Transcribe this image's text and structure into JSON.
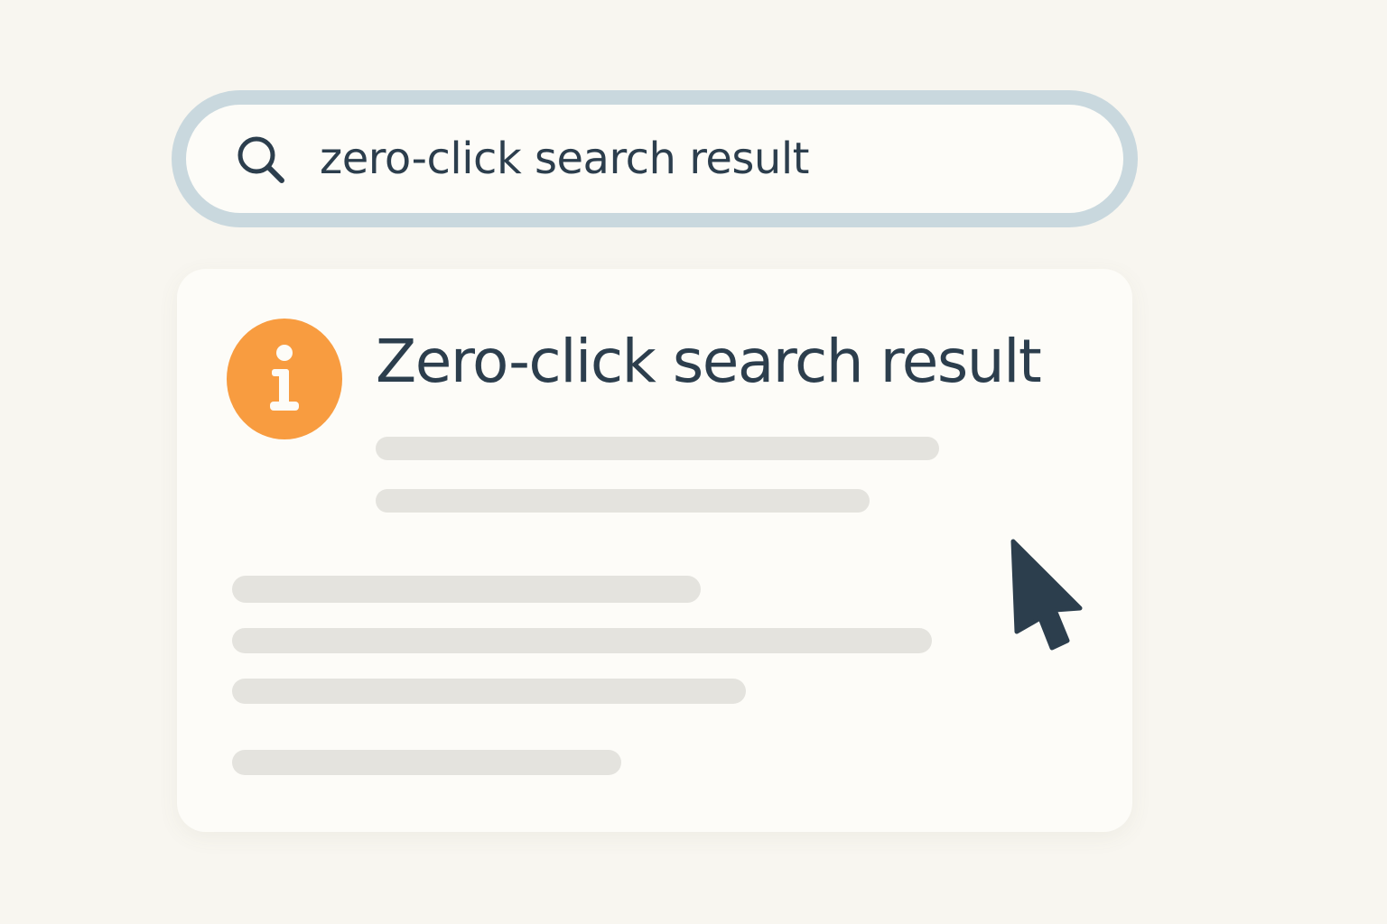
{
  "search": {
    "query": "zero-click search result",
    "icon": "search-icon"
  },
  "result": {
    "title": "Zero-click search result",
    "icon": "info-icon",
    "icon_color": "#f89c40"
  },
  "colors": {
    "background": "#f8f6f0",
    "search_border": "#c9d8de",
    "text": "#2c3e4d",
    "placeholder": "#e4e3de"
  },
  "cursor": {
    "icon": "mouse-pointer-icon"
  }
}
